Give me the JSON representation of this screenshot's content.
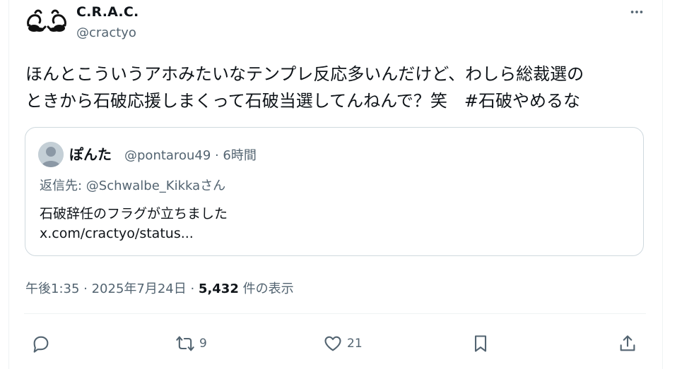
{
  "author": {
    "name": "C.R.A.C.",
    "handle": "@cractyo",
    "avatar_icon": "hand-gesture-icon"
  },
  "tweet": {
    "text_line1": "ほんとこういうアホみたいなテンプレ反応多いんだけど、わしら総裁選の",
    "text_line2_prefix": "ときから石破応援しまくって石破当選してんねんで？笑　",
    "hashtag": "#石破やめるな"
  },
  "quote": {
    "name": "ぽんた",
    "meta": "@pontarou49 · 6時間",
    "reply_prefix": "返信先: ",
    "reply_mention": "@Schwalbe_Kikka",
    "reply_suffix": "さん",
    "body": "石破辞任のフラグが立ちました",
    "link": "x.com/cractyo/status..."
  },
  "meta": {
    "timestamp": "午後1:35 · 2025年7月24日 · ",
    "views_count": "5,432",
    "views_suffix": " 件の表示"
  },
  "actions": {
    "retweets": "9",
    "likes": "21"
  },
  "colors": {
    "text": "#0f1419",
    "secondary": "#536471",
    "border": "#cfd9de"
  }
}
